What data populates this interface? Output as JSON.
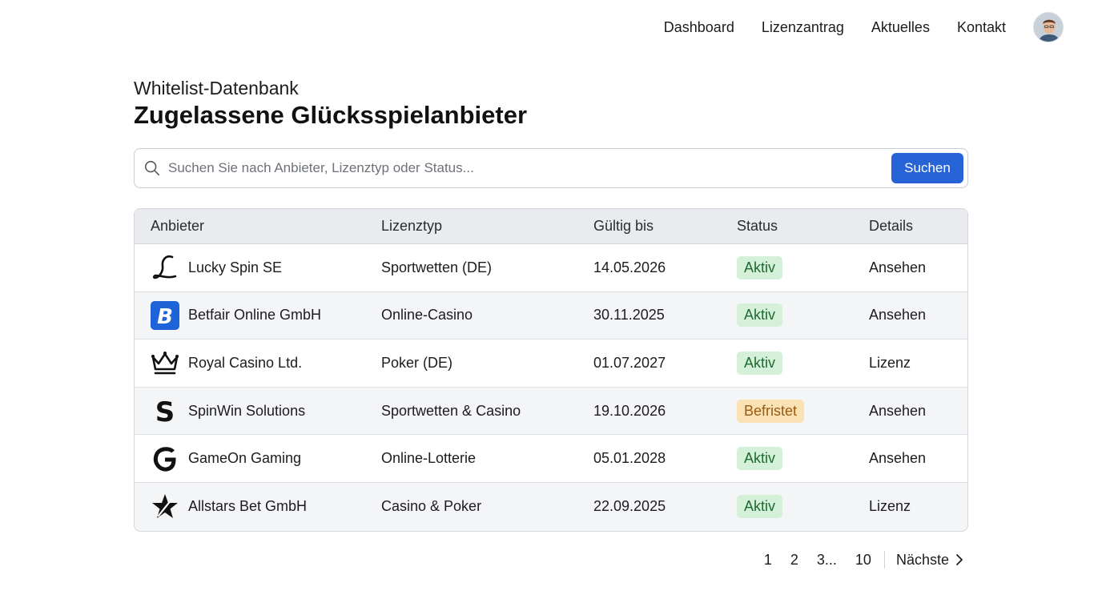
{
  "nav": {
    "items": [
      "Dashboard",
      "Lizenzantrag",
      "Aktuelles",
      "Kontakt"
    ]
  },
  "header": {
    "subtitle": "Whitelist-Datenbank",
    "title": "Zugelassene Glücksspielanbieter"
  },
  "search": {
    "value": "",
    "placeholder": "Suchen Sie nach Anbieter, Lizenztyp oder Status...",
    "button_label": "Suchen"
  },
  "table": {
    "columns": [
      "Anbieter",
      "Lizenztyp",
      "Gültig bis",
      "Status",
      "Details"
    ],
    "rows": [
      {
        "logo_icon": "script-l-icon",
        "provider": "Lucky Spin SE",
        "license": "Sportwetten (DE)",
        "valid_until": "14.05.2026",
        "status": "Aktiv",
        "status_type": "ok",
        "details": "Ansehen"
      },
      {
        "logo_icon": "blue-b-icon",
        "provider": "Betfair Online GmbH",
        "license": "Online-Casino",
        "valid_until": "30.11.2025",
        "status": "Aktiv",
        "status_type": "ok",
        "details": "Ansehen"
      },
      {
        "logo_icon": "crown-icon",
        "provider": "Royal Casino Ltd.",
        "license": "Poker (DE)",
        "valid_until": "01.07.2027",
        "status": "Aktiv",
        "status_type": "ok",
        "details": "Lizenz"
      },
      {
        "logo_icon": "letter-s-icon",
        "provider": "SpinWin Solutions",
        "license": "Sportwetten & Casino",
        "valid_until": "19.10.2026",
        "status": "Befristet",
        "status_type": "warn",
        "details": "Ansehen"
      },
      {
        "logo_icon": "letter-g-icon",
        "provider": "GameOn Gaming",
        "license": "Online-Lotterie",
        "valid_until": "05.01.2028",
        "status": "Aktiv",
        "status_type": "ok",
        "details": "Ansehen"
      },
      {
        "logo_icon": "star-icon",
        "provider": "Allstars Bet GmbH",
        "license": "Casino & Poker",
        "valid_until": "22.09.2025",
        "status": "Aktiv",
        "status_type": "ok",
        "details": "Lizenz"
      }
    ]
  },
  "pagination": {
    "pages": [
      "1",
      "2",
      "3...",
      "10"
    ],
    "next_label": "Nächste"
  },
  "colors": {
    "accent": "#2563d6",
    "status_ok_bg": "#d5f0d9",
    "status_warn_bg": "#fbe2b4"
  }
}
